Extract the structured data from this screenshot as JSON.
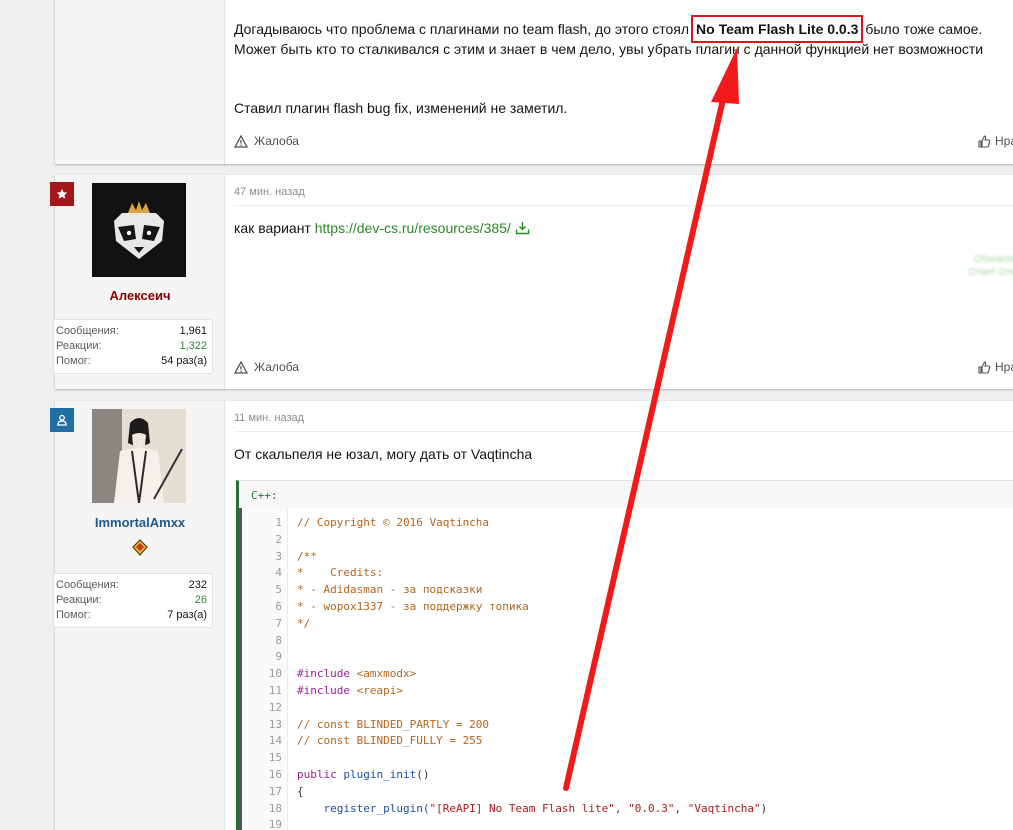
{
  "post1": {
    "line1_before": "Догадываюсь что проблема с плагинами no team flash, до этого стоял",
    "highlight": "No Team Flash Lite 0.0.3",
    "line1_after": "было тоже самое.",
    "line2": "Может быть кто то сталкивался с этим и знает в чем дело, увы убрать плагин с данной функцией нет возможности",
    "line3": "Ставил плагин flash bug fix, изменений не заметил.",
    "report": "Жалоба",
    "like": "Нравится"
  },
  "post2": {
    "time": "47 мин. назад",
    "username": "Алексеич",
    "username_color": "#8b0000",
    "badge_color": "#a4161a",
    "text_before": "как вариант",
    "link": "https://dev-cs.ru/resources/385/",
    "blur_text": "Обновлено Ответ Ответ",
    "stats": [
      {
        "label": "Сообщения:",
        "value": "1,961",
        "green": false
      },
      {
        "label": "Реакции:",
        "value": "1,322",
        "green": true
      },
      {
        "label": "Помог:",
        "value": "54 раз(а)",
        "green": false
      }
    ],
    "report": "Жалоба",
    "like": "Нравится"
  },
  "post3": {
    "time": "11 мин. назад",
    "username": "ImmortalAmxx",
    "username_color": "#1e5a8c",
    "badge_color": "#1f6fa5",
    "text": "От скальпеля не юзал, могу дать от Vaqtincha",
    "stats": [
      {
        "label": "Сообщения:",
        "value": "232",
        "green": false
      },
      {
        "label": "Реакции:",
        "value": "26",
        "green": true
      },
      {
        "label": "Помог:",
        "value": "7 раз(а)",
        "green": false
      }
    ],
    "code_lang": "C++:",
    "code_lines": [
      {
        "n": "1",
        "t": "// Copyright © 2016 Vaqtincha",
        "k": "com"
      },
      {
        "n": "2",
        "t": "",
        "k": "plain"
      },
      {
        "n": "3",
        "t": "/**",
        "k": "com"
      },
      {
        "n": "4",
        "t": "*    Credits:",
        "k": "com"
      },
      {
        "n": "5",
        "t": "* - Adidasman - за подсказки",
        "k": "com"
      },
      {
        "n": "6",
        "t": "* - wopox1337 - за поддержку топика",
        "k": "com"
      },
      {
        "n": "7",
        "t": "*/",
        "k": "com"
      },
      {
        "n": "8",
        "t": "",
        "k": "plain"
      },
      {
        "n": "9",
        "t": "",
        "k": "plain"
      },
      {
        "n": "10",
        "t": "#include",
        "t2": " <amxmodx>",
        "k": "inc"
      },
      {
        "n": "11",
        "t": "#include",
        "t2": " <reapi>",
        "k": "inc"
      },
      {
        "n": "12",
        "t": "",
        "k": "plain"
      },
      {
        "n": "13",
        "t": "// const BLINDED_PARTLY = 200",
        "k": "com"
      },
      {
        "n": "14",
        "t": "// const BLINDED_FULLY = 255",
        "k": "com"
      },
      {
        "n": "15",
        "t": "",
        "k": "plain"
      },
      {
        "n": "16",
        "t": "public",
        "t2": " plugin_init",
        "t3": "()",
        "k": "fn"
      },
      {
        "n": "17",
        "t": "{",
        "k": "plain"
      },
      {
        "n": "18",
        "t": "    register_plugin(",
        "t2": "\"[ReAPI] No Team Flash lite\"",
        "t3": ", ",
        "t4": "\"0.0.3\"",
        "t5": ", ",
        "t6": "\"Vaqtincha\"",
        "t7": ")",
        "k": "reg"
      },
      {
        "n": "19",
        "t": "",
        "k": "plain"
      }
    ]
  }
}
